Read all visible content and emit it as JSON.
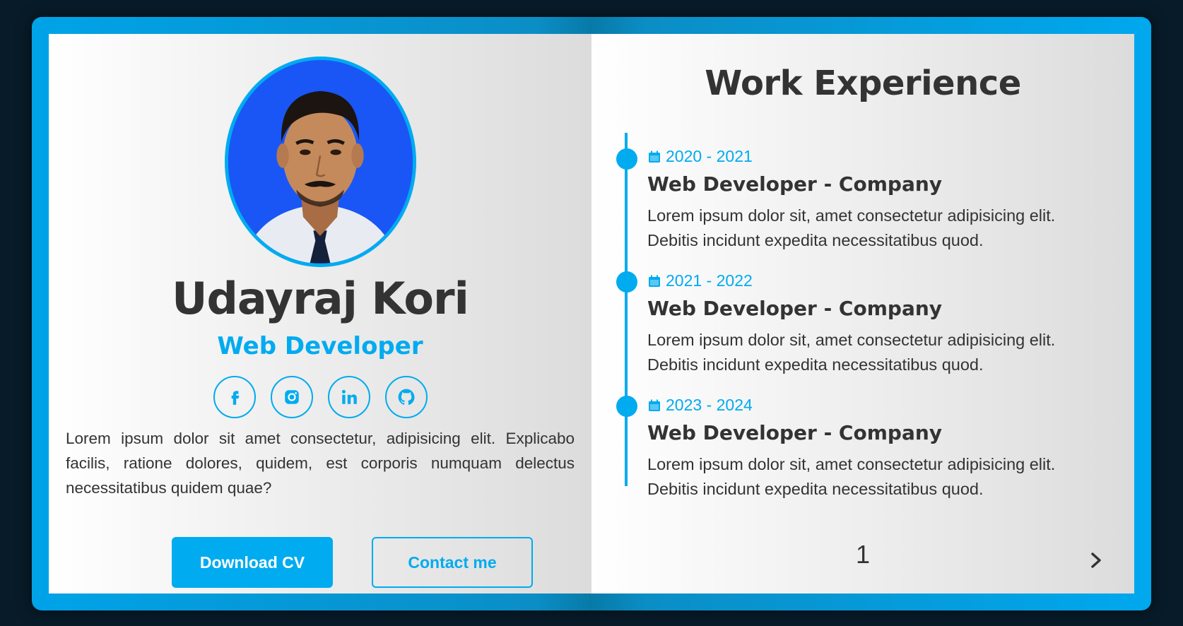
{
  "profile": {
    "name": "Udayraj Kori",
    "role": "Web Developer",
    "about": "Lorem ipsum dolor sit amet consectetur, adipisicing elit. Explicabo facilis, ratione dolores, quidem, est corporis numquam delectus necessitatibus quidem quae?",
    "socials": [
      {
        "icon": "facebook-icon"
      },
      {
        "icon": "instagram-icon"
      },
      {
        "icon": "linkedin-icon"
      },
      {
        "icon": "github-icon"
      }
    ],
    "download_label": "Download CV",
    "contact_label": "Contact me"
  },
  "experience": {
    "title": "Work Experience",
    "items": [
      {
        "date": "2020 - 2021",
        "role": "Web Developer - Company",
        "desc": "Lorem ipsum dolor sit, amet consectetur adipisicing elit. Debitis incidunt expedita necessitatibus quod."
      },
      {
        "date": "2021 - 2022",
        "role": "Web Developer - Company",
        "desc": "Lorem ipsum dolor sit, amet consectetur adipisicing elit. Debitis incidunt expedita necessitatibus quod."
      },
      {
        "date": "2023 - 2024",
        "role": "Web Developer - Company",
        "desc": "Lorem ipsum dolor sit, amet consectetur adipisicing elit. Debitis incidunt expedita necessitatibus quod."
      }
    ]
  },
  "pagination": {
    "page_number": "1",
    "next_icon": "chevron-right-icon"
  },
  "colors": {
    "accent": "#00abf0",
    "background": "#081b29",
    "text": "#333333"
  }
}
